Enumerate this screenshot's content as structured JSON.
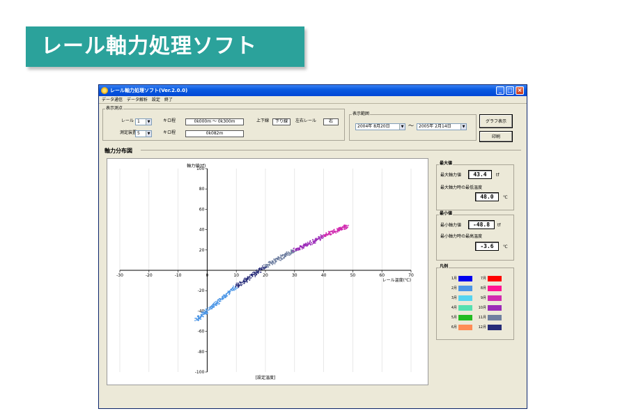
{
  "banner": {
    "title": "レール軸力処理ソフト"
  },
  "window": {
    "title": "レール軸力処理ソフト(Ver.2.0.0)",
    "minimize": "_",
    "maximize": "□",
    "close": "×"
  },
  "menu": [
    "データ通信",
    "データ解析",
    "設定",
    "終了"
  ],
  "display_points": {
    "group_title": "表示測点",
    "rail_label": "レール",
    "rail_value": "1",
    "km_label": "キロ程",
    "km_range": "0k000m 〜 0k300m",
    "updown_label": "上下線",
    "updown_value": "下り線",
    "lr_label": "左右レール",
    "lr_value": "右",
    "device_label": "測定装置",
    "device_value": "5",
    "km2_label": "キロ程",
    "km2_value": "0k082m"
  },
  "display_range": {
    "group_title": "表示範囲",
    "start": "2004年 8月20日",
    "tilde": "〜",
    "end": "2005年 2月14日"
  },
  "buttons": {
    "graph": "グラフ表示",
    "print": "印刷"
  },
  "section_title": "軸力分布図",
  "max_panel": {
    "title": "最大値",
    "axial_label": "最大軸力値",
    "axial_value": "43.4",
    "axial_unit": "tf",
    "temp_label": "最大軸力時の最低温度",
    "temp_value": "48.0",
    "temp_unit": "℃"
  },
  "min_panel": {
    "title": "最小値",
    "axial_label": "最小軸力値",
    "axial_value": "-48.8",
    "axial_unit": "tf",
    "temp_label": "最小軸力時の最高温度",
    "temp_value": "-3.6",
    "temp_unit": "℃"
  },
  "legend": {
    "title": "凡例",
    "items": [
      {
        "label": "1月",
        "color": "#0000ee"
      },
      {
        "label": "2月",
        "color": "#4c96e6"
      },
      {
        "label": "3月",
        "color": "#55d4f0"
      },
      {
        "label": "4月",
        "color": "#55e0b0"
      },
      {
        "label": "5月",
        "color": "#22bb22"
      },
      {
        "label": "6月",
        "color": "#ff8c55"
      },
      {
        "label": "7月",
        "color": "#ff0000"
      },
      {
        "label": "8月",
        "color": "#ff1493"
      },
      {
        "label": "9月",
        "color": "#d12bb0"
      },
      {
        "label": "10月",
        "color": "#9b2bb8"
      },
      {
        "label": "11月",
        "color": "#6f7fa0"
      },
      {
        "label": "12月",
        "color": "#262b78"
      }
    ]
  },
  "chart_data": {
    "type": "scatter",
    "ylabel": "軸力値(tf)",
    "xlabel": "レール温度(℃)",
    "footer_label": "設定温度",
    "xlim": [
      -30,
      70
    ],
    "ylim": [
      -100,
      100
    ],
    "x_ticks": [
      -30,
      -20,
      -10,
      0,
      10,
      20,
      30,
      40,
      50,
      60,
      70
    ],
    "y_ticks": [
      -100,
      -80,
      -60,
      -40,
      -20,
      20,
      40,
      60,
      80,
      100
    ],
    "grid": true,
    "series": [
      {
        "color": "#4c96e6",
        "x": [
          -3.6,
          0,
          5,
          10
        ],
        "y": [
          -48.8,
          -40,
          -28,
          -16
        ]
      },
      {
        "color": "#262b78",
        "x": [
          10,
          15,
          20
        ],
        "y": [
          -16,
          -6,
          4
        ]
      },
      {
        "color": "#6f7fa0",
        "x": [
          20,
          25,
          30
        ],
        "y": [
          4,
          12,
          20
        ]
      },
      {
        "color": "#9b2bb8",
        "x": [
          30,
          35,
          40
        ],
        "y": [
          20,
          26,
          34
        ]
      },
      {
        "color": "#d12bb0",
        "x": [
          40,
          45,
          48
        ],
        "y": [
          34,
          40,
          43.4
        ]
      }
    ]
  }
}
